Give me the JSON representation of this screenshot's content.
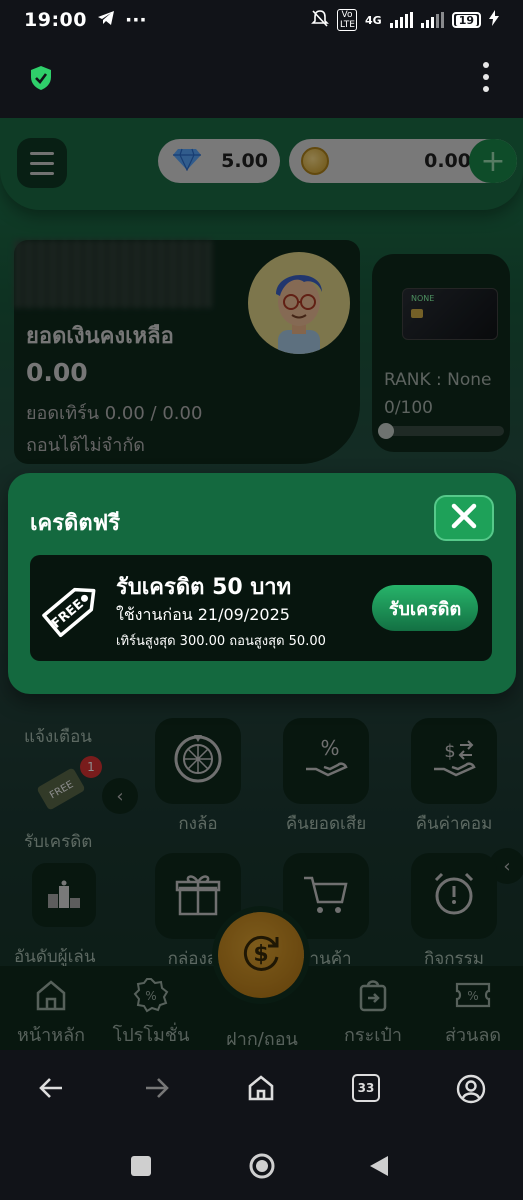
{
  "status_bar": {
    "time": "19:00",
    "network": "4G",
    "volte": "Vo LTE",
    "battery": "19"
  },
  "header": {
    "gems_value": "5.00",
    "coins_value": "0.00",
    "add_label": "+"
  },
  "balance": {
    "label": "ยอดเงินคงเหลือ",
    "value": "0.00",
    "turnover": "ยอดเทิร์น 0.00 / 0.00",
    "withdraw": "ถอนได้ไม่จำกัด"
  },
  "rank": {
    "label": "RANK : None",
    "progress_text": "0/100",
    "progress": 0,
    "card_name": "NONE"
  },
  "menu": {
    "wheel": "กงล้อ",
    "cashback": "คืนยอดเสีย",
    "commission": "คืนค่าคอม",
    "giftbox": "กล่องสุ่ม",
    "shop": "ร้านค้า",
    "activities": "กิจกรรม"
  },
  "side": {
    "notify": "แจ้งเตือน",
    "get_credit": "รับเครดิต",
    "notify_badge": "1",
    "ranking": "อันดับผู้เล่น",
    "free_tag": "FREE"
  },
  "bottom_nav": {
    "home": "หน้าหลัก",
    "promotion": "โปรโมชั่น",
    "deposit": "ฝาก/ถอน",
    "wallet": "กระเป๋า",
    "discount": "ส่วนลด"
  },
  "modal": {
    "title": "เครดิตฟรี",
    "promo_title": "รับเครดิต 50 บาท",
    "promo_expire": "ใช้งานก่อน 21/09/2025",
    "promo_limit": "เทิร์นสูงสุด 300.00 ถอนสูงสุด 50.00",
    "promo_button": "รับเครดิต",
    "tag_text": "FREE"
  },
  "browser": {
    "tab_count": "33"
  },
  "colors": {
    "brand_green": "#14693f",
    "accent_gold": "#d4a22a",
    "dark_panel": "#0f2a1d"
  }
}
